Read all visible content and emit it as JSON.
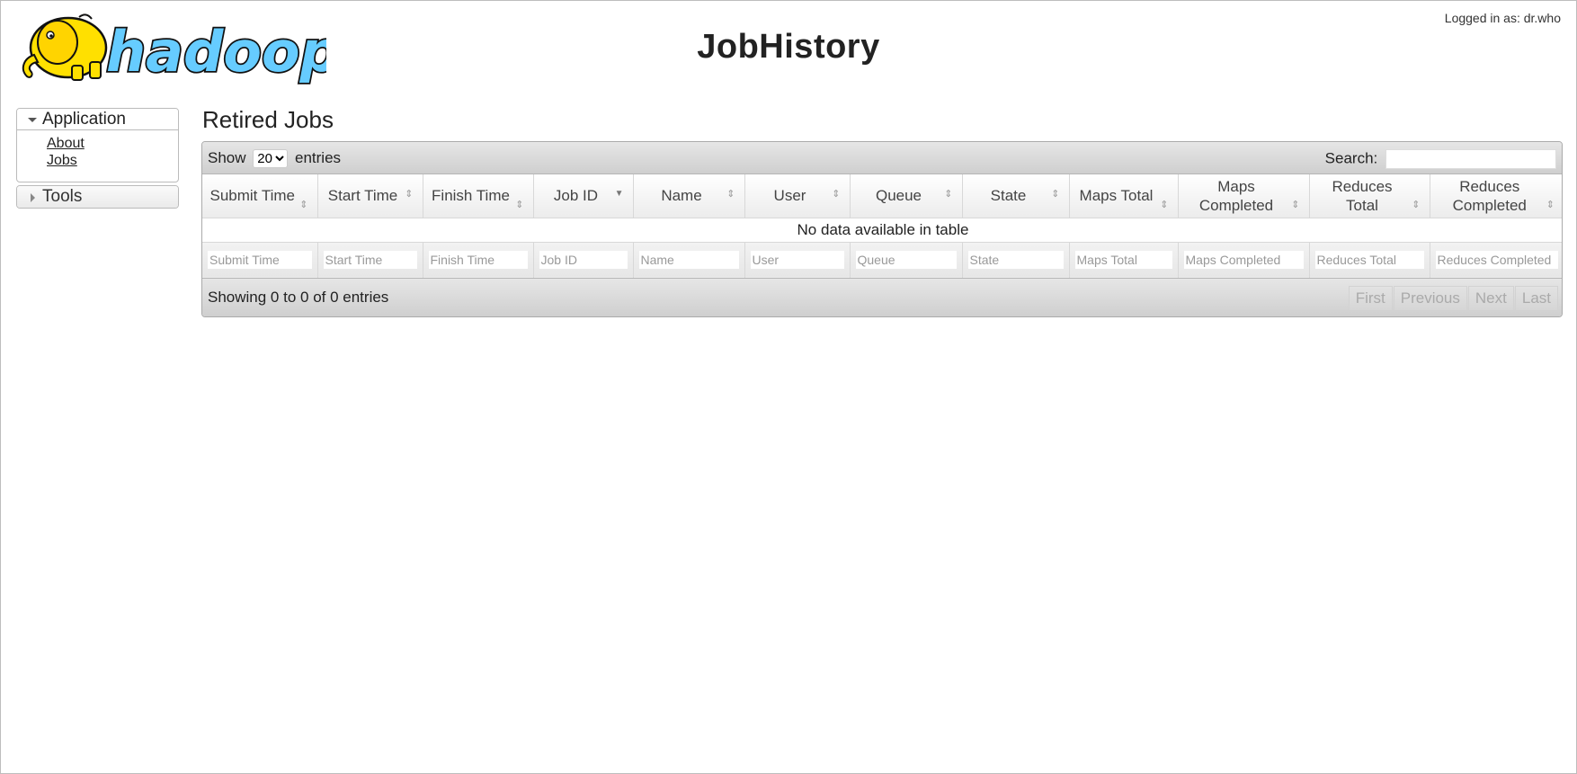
{
  "header": {
    "logo_text": "hadoop",
    "title": "JobHistory",
    "login": "Logged in as: dr.who"
  },
  "sidebar": {
    "sections": [
      {
        "label": "Application",
        "expanded": true,
        "links": [
          "About",
          "Jobs"
        ]
      },
      {
        "label": "Tools",
        "expanded": false,
        "links": []
      }
    ]
  },
  "main": {
    "title": "Retired Jobs",
    "length_menu": {
      "prefix": "Show",
      "selected": "20",
      "options": [
        "20"
      ],
      "suffix": "entries"
    },
    "search_label": "Search:",
    "search_value": "",
    "columns": [
      {
        "label": "Submit Time",
        "sort": "both"
      },
      {
        "label": "Start Time",
        "sort": "both"
      },
      {
        "label": "Finish Time",
        "sort": "both"
      },
      {
        "label": "Job ID",
        "sort": "desc"
      },
      {
        "label": "Name",
        "sort": "both"
      },
      {
        "label": "User",
        "sort": "both"
      },
      {
        "label": "Queue",
        "sort": "both"
      },
      {
        "label": "State",
        "sort": "both"
      },
      {
        "label": "Maps Total",
        "sort": "both"
      },
      {
        "label": "Maps Completed",
        "sort": "both"
      },
      {
        "label": "Reduces Total",
        "sort": "both"
      },
      {
        "label": "Reduces Completed",
        "sort": "both"
      }
    ],
    "empty_message": "No data available in table",
    "filters": [
      "Submit Time",
      "Start Time",
      "Finish Time",
      "Job ID",
      "Name",
      "User",
      "Queue",
      "State",
      "Maps Total",
      "Maps Completed",
      "Reduces Total",
      "Reduces Completed"
    ],
    "info": "Showing 0 to 0 of 0 entries",
    "pagination": [
      "First",
      "Previous",
      "Next",
      "Last"
    ]
  },
  "colors": {
    "logo_yellow": "#ffe000",
    "logo_blue": "#66ccff",
    "logo_outline": "#111111"
  }
}
